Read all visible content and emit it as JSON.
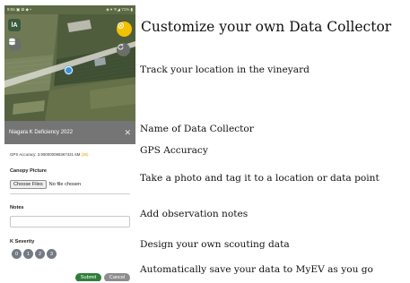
{
  "status_bar": {
    "left": "9:55 ▣ ✿ ◆ •",
    "right": "◈ ▾ ᯤ◢ 71% ▮"
  },
  "map": {
    "logo_text": "lA"
  },
  "form": {
    "title": "Niagara K Deficiency 2022",
    "close_symbol": "✕",
    "gps_label": "GPS Accuracy:",
    "gps_value": "3.900000095367431 6M",
    "gps_badge": "(36)",
    "canopy_label": "Canopy Picture",
    "choose_files": "Choose Files",
    "no_file": "No file chosen",
    "notes_label": "Notes",
    "notes_value": "",
    "severity_label": "K Severity",
    "severity_options": [
      "0",
      "1",
      "2",
      "3"
    ],
    "submit": "Submit",
    "cancel": "Cancel"
  },
  "captions": {
    "heading": "Customize your own Data Collector",
    "track": "Track your location in the vineyard",
    "name": "Name of Data Collector",
    "gps": "GPS Accuracy",
    "photo": "Take a photo and tag it to a location or data point",
    "notes": "Add observation notes",
    "design": "Design your own scouting data",
    "save": "Automatically save your data to MyEV as you go"
  },
  "colors": {
    "submit": "#2f7d3b",
    "cancel": "#8d8d8d",
    "gps_button": "#f2c100",
    "title_bar": "#757575",
    "location_dot": "#3d8fd8"
  }
}
